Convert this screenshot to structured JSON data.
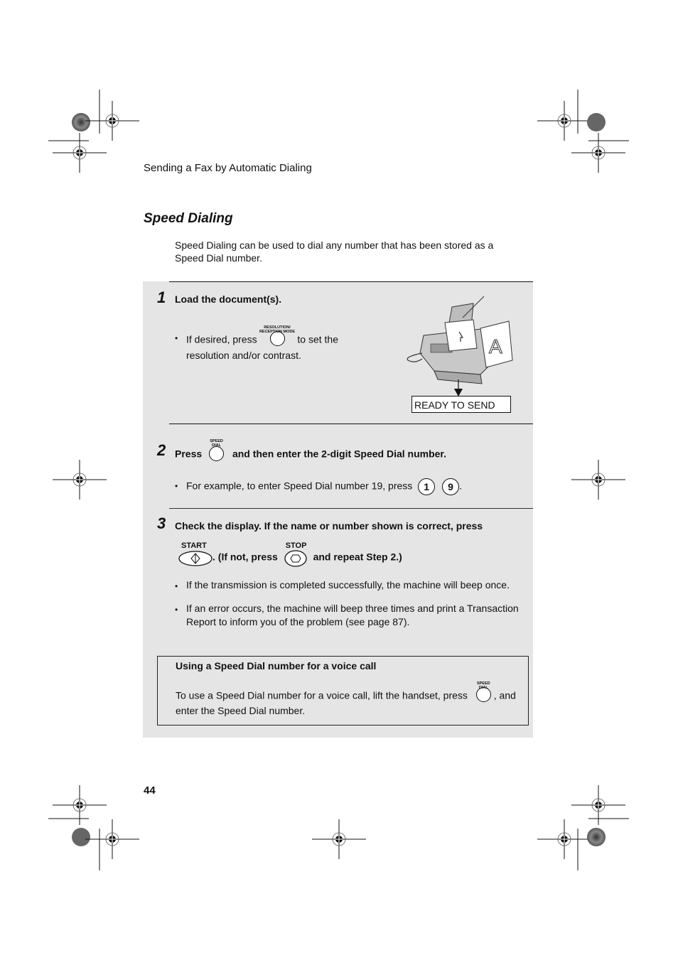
{
  "header": {
    "running_title": "Sending a Fax by Automatic Dialing"
  },
  "section": {
    "title": "Speed Dialing",
    "intro_line1": "Speed Dialing can be used to dial any number that has been stored as a",
    "intro_line2": "Speed Dial number."
  },
  "steps": [
    {
      "number": "1",
      "heading": "Load the document(s).",
      "bullet_prefix": "If desired, press",
      "key_label_line1": "RESOLUTION/",
      "key_label_line2": "RECEPTION MODE",
      "bullet_suffix": "to set the",
      "bullet_line2": "resolution and/or contrast.",
      "display_text": "READY TO SEND",
      "illustration_letter": "A"
    },
    {
      "number": "2",
      "heading_prefix": "Press",
      "key_label_line1": "SPEED",
      "key_label_line2": "DIAL",
      "heading_suffix": "and then enter the 2-digit Speed Dial number.",
      "bullet_prefix": "For example, to enter Speed Dial number 19, press",
      "keys": [
        "1",
        "9"
      ],
      "bullet_suffix": "."
    },
    {
      "number": "3",
      "heading_line1": "Check the display. If the name or number shown is correct, press",
      "start_label": "START",
      "mid_text": ". (If not, press",
      "stop_label": "STOP",
      "end_text": "and repeat Step 2.)",
      "bullets": [
        "If the transmission is completed successfully, the machine will beep once.",
        "If an error occurs, the machine will beep three times and print a Transaction",
        "Report to inform you of the problem (see page 87)."
      ]
    }
  ],
  "note": {
    "title": "Using a Speed Dial number for a voice call",
    "text_prefix": "To use a Speed Dial number for a voice call, lift the handset, press",
    "key_label_line1": "SPEED",
    "key_label_line2": "DIAL",
    "text_suffix": ", and",
    "text_line2": "enter the Speed Dial number."
  },
  "footer": {
    "page_number": "44"
  },
  "icons": {
    "bullet": "•",
    "registration_mark": "crosshair-target",
    "color_target": "radial-starburst"
  },
  "colors": {
    "panel_bg": "#e5e5e5",
    "text": "#111111"
  }
}
